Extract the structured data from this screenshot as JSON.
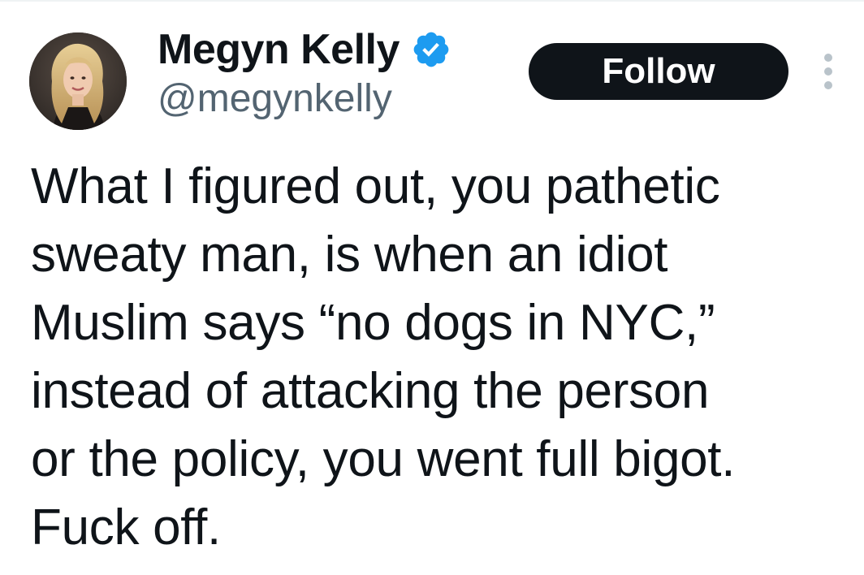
{
  "author": {
    "display_name": "Megyn Kelly",
    "handle": "@megynkelly",
    "verified": true,
    "verified_icon": "verified-badge-icon"
  },
  "actions": {
    "follow_label": "Follow",
    "more_icon": "more-options-icon"
  },
  "tweet": {
    "text": "What I figured out, you pathetic\nsweaty man, is when an idiot\nMuslim says “no dogs in NYC,”\ninstead of attacking the person\nor the policy, you went full bigot.\nFuck off."
  },
  "colors": {
    "text_primary": "#0f1419",
    "text_secondary": "#536471",
    "verified_blue": "#1d9bf0",
    "follow_bg": "#0f1419",
    "follow_text": "#ffffff"
  }
}
